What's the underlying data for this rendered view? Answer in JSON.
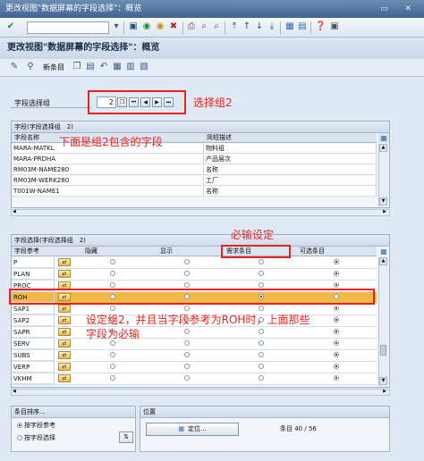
{
  "window": {
    "title": "更改视图\"数据屏幕的字段选择\"：概览",
    "controls": "▭ ✕"
  },
  "toolbar": {
    "command_value": ""
  },
  "screen": {
    "title": "更改视图\"数据屏幕的字段选择\"：概览"
  },
  "app_toolbar": {
    "new_entries": "新条目"
  },
  "group_selector": {
    "label": "字段选择组",
    "value": "2",
    "annotation": "选择组2"
  },
  "fields_panel": {
    "header": "字段(字段选择组　2)",
    "col1": "字段名称",
    "col2": "简短描述",
    "annotation": "下面是组2包含的字段",
    "rows": [
      {
        "name": "MARA-MATKL",
        "desc": "物料组"
      },
      {
        "name": "MARA-PRDHA",
        "desc": "产品层次"
      },
      {
        "name": "RM03M-NAME280",
        "desc": "名称"
      },
      {
        "name": "RM03M-WERK280",
        "desc": "工厂"
      },
      {
        "name": "T001W-NAME1",
        "desc": "名称"
      }
    ]
  },
  "selection_panel": {
    "header": "字段选择(字段选择组　2)",
    "annotation_required": "必输设定",
    "annotation_note_line1": "设定组2，并且当字段参考为ROH时，上面那些",
    "annotation_note_line2": "字段为必输",
    "columns": [
      "字段参考",
      "隐藏",
      "显示",
      "需求条目",
      "可选条目"
    ],
    "rows": [
      {
        "ref": "P",
        "sel": 4
      },
      {
        "ref": "PLAN",
        "sel": 4
      },
      {
        "ref": "PROC",
        "sel": 4
      },
      {
        "ref": "ROH",
        "sel": 3
      },
      {
        "ref": "SAP1",
        "sel": 4
      },
      {
        "ref": "SAP2",
        "sel": 4
      },
      {
        "ref": "SAPR",
        "sel": 4
      },
      {
        "ref": "SERV",
        "sel": 4
      },
      {
        "ref": "SUBS",
        "sel": 4
      },
      {
        "ref": "VERP",
        "sel": 4
      },
      {
        "ref": "VKHM",
        "sel": 4
      }
    ]
  },
  "sort_panel": {
    "header": "条目排序...",
    "opt1": "按字段参考",
    "opt2": "按字段选择"
  },
  "position_panel": {
    "header": "位置",
    "button": "定位...",
    "entry_count": "条目 40 / 56"
  },
  "colors": {
    "annotation": "#e8231e",
    "highlight_row": "#f0b848"
  }
}
